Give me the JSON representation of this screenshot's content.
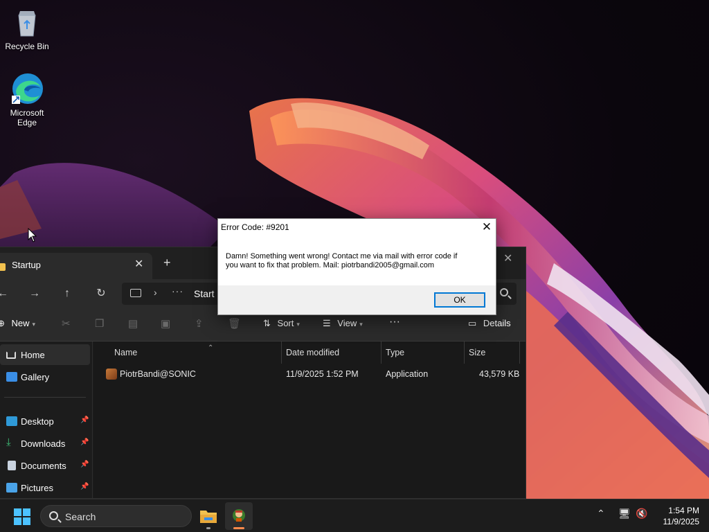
{
  "desktop": {
    "icons": [
      {
        "label": "Recycle Bin",
        "icon": "recycle-bin-icon"
      },
      {
        "label": "Microsoft\nEdge",
        "label_line1": "Microsoft",
        "label_line2": "Edge",
        "icon": "edge-icon"
      }
    ]
  },
  "explorer": {
    "tab_title": "Startup",
    "close_glyph": "✕",
    "newtab_glyph": "+",
    "address": {
      "ellipsis": "···",
      "crumb": "Start Menu"
    },
    "commands": {
      "new": "New",
      "sort": "Sort",
      "view": "View",
      "more": "···",
      "details": "Details"
    },
    "sidebar": {
      "items": [
        {
          "label": "Home",
          "icon": "home-icon",
          "selected": true
        },
        {
          "label": "Gallery",
          "icon": "gallery-icon"
        },
        {
          "label": "Desktop",
          "icon": "desktop-icon",
          "pinned": true
        },
        {
          "label": "Downloads",
          "icon": "downloads-icon",
          "pinned": true
        },
        {
          "label": "Documents",
          "icon": "documents-icon",
          "pinned": true
        },
        {
          "label": "Pictures",
          "icon": "pictures-icon",
          "pinned": true
        }
      ]
    },
    "columns": [
      "Name",
      "Date modified",
      "Type",
      "Size"
    ],
    "rows": [
      {
        "name": "PiotrBandi@SONIC",
        "date": "11/9/2025 1:52 PM",
        "type": "Application",
        "size": "43,579 KB"
      }
    ]
  },
  "dialog": {
    "title": "Error Code: #9201",
    "message_line1": "Damn! Something went wrong! Contact me via mail with error code if",
    "message_line2": "you want to fix that problem. Mail: piotrbandi2005@gmail.com",
    "ok_label": "OK",
    "close_glyph": "✕"
  },
  "taskbar": {
    "search_label": "Search",
    "time": "1:54 PM",
    "date": "11/9/2025",
    "accent": "#4cc2ff"
  }
}
